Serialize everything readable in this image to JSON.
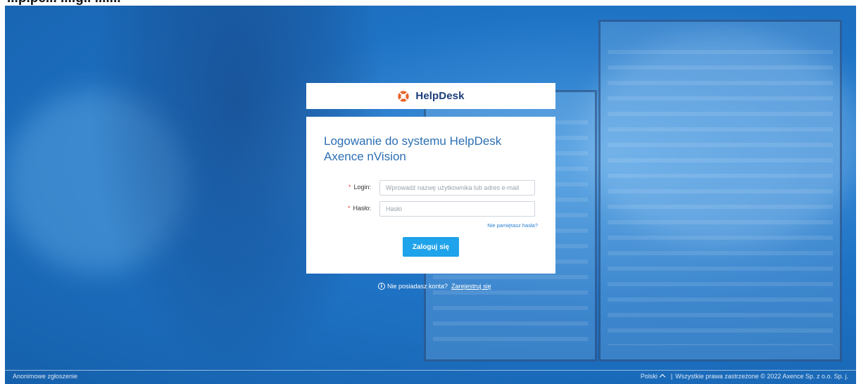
{
  "header": {
    "partial_title": "...p.pe... ....g.. ...i..."
  },
  "brand": {
    "name": "HelpDesk",
    "accent": "#e8622a",
    "text_color": "#1a3d7a"
  },
  "login_form": {
    "title_line1": "Logowanie do systemu HelpDesk",
    "title_line2": "Axence nVision",
    "login_label": "Login:",
    "login_placeholder": "Wprowadź nazwę użytkownika lub adres e-mail",
    "login_value": "",
    "password_label": "Hasło:",
    "password_placeholder": "Hasło",
    "password_value": "",
    "required_mark": "*",
    "forgot_link": "Nie pamiętasz hasła?",
    "submit_label": "Zaloguj się",
    "submit_color": "#1fa3ea"
  },
  "register_prompt": {
    "icon": "info-icon",
    "text": "Nie posiadasz konta?",
    "link": "Zarejestruj się"
  },
  "footer": {
    "anonymous_report": "Anonimowe zgłoszenie",
    "language": "Polski",
    "language_icon": "chevron-up-icon",
    "separator": "|",
    "copyright": "Wszystkie prawa zastrzeżone © 2022 Axence Sp. z o.o. Sp. j."
  },
  "colors": {
    "background": "#1f73c5",
    "title_text": "#2d6fb3",
    "link": "#2a7fd1",
    "required": "#e2463a"
  }
}
